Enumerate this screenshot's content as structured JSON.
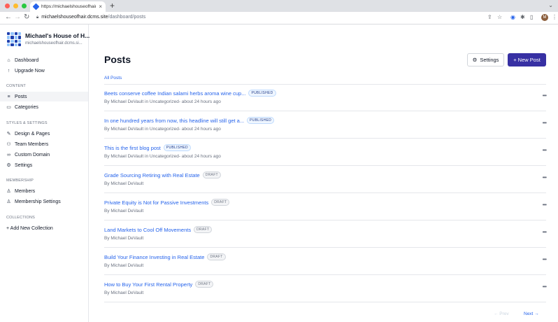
{
  "browser": {
    "tab_title": "https://michaelshouseofhair.dcms...",
    "url_host": "michaelshouseofhair.dcms.site",
    "url_path": "/dashboard/posts",
    "avatar_letter": "M"
  },
  "sidebar": {
    "brand_name": "Michael's House of H...",
    "brand_url": "michaelshouseofhair.dcms.si...",
    "top_items": [
      {
        "label": "Dashboard",
        "icon": "home-icon"
      },
      {
        "label": "Upgrade Now",
        "icon": "rocket-icon"
      }
    ],
    "content_heading": "CONTENT",
    "content_items": [
      {
        "label": "Posts",
        "icon": "list-icon",
        "active": true
      },
      {
        "label": "Categories",
        "icon": "folder-icon"
      }
    ],
    "styles_heading": "STYLES & SETTINGS",
    "styles_items": [
      {
        "label": "Design & Pages",
        "icon": "brush-icon"
      },
      {
        "label": "Team Members",
        "icon": "users-icon"
      },
      {
        "label": "Custom Domain",
        "icon": "link-icon"
      },
      {
        "label": "Settings",
        "icon": "gear-icon"
      }
    ],
    "membership_heading": "MEMBERSHIP",
    "membership_items": [
      {
        "label": "Members",
        "icon": "user-icon"
      },
      {
        "label": "Membership Settings",
        "icon": "user-settings-icon"
      }
    ],
    "collections_heading": "COLLECTIONS",
    "add_collection": "+ Add New Collection"
  },
  "main": {
    "title": "Posts",
    "settings_label": "Settings",
    "new_post_label": "+ New Post",
    "tab_all": "All Posts",
    "posts": [
      {
        "title": "Beets conserve coffee Indian salami herbs aroma wine cup...",
        "status": "PUBLISHED",
        "meta": "By Michael DeVault in Uncategorized- about 24 hours ago"
      },
      {
        "title": "In one hundred years from now, this headline will still get a...",
        "status": "PUBLISHED",
        "meta": "By Michael DeVault in Uncategorized- about 24 hours ago"
      },
      {
        "title": "This is the first blog post",
        "status": "PUBLISHED",
        "meta": "By Michael DeVault in Uncategorized- about 24 hours ago"
      },
      {
        "title": "Grade Sourcing Retiring with Real Estate",
        "status": "DRAFT",
        "meta": "By Michael DeVault"
      },
      {
        "title": "Private Equity is Not for Passive Investments",
        "status": "DRAFT",
        "meta": "By Michael DeVault"
      },
      {
        "title": "Land Markets to Cool Off Movements",
        "status": "DRAFT",
        "meta": "By Michael DeVault"
      },
      {
        "title": "Build Your Finance Investing in Real Estate",
        "status": "DRAFT",
        "meta": "By Michael DeVault"
      },
      {
        "title": "How to Buy Your First Rental Property",
        "status": "DRAFT",
        "meta": "By Michael DeVault"
      }
    ],
    "prev_label": "← Prev",
    "next_label": "Next →"
  },
  "colors": {
    "accent": "#2563eb",
    "primary_button": "#3730a3"
  }
}
